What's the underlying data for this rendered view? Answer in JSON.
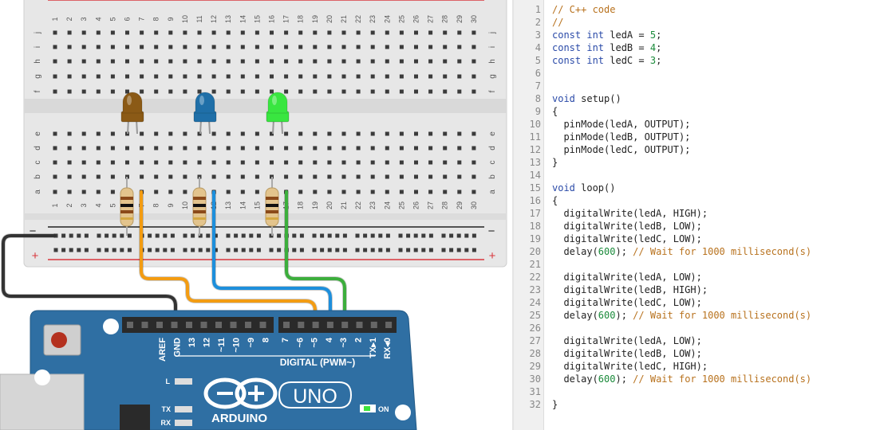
{
  "colors": {
    "breadboard": "#e7e7e7",
    "board_blue": "#2f6fa3",
    "wire_orange": "#f39c12",
    "wire_blue": "#1d8fdc",
    "wire_green": "#3cae3c",
    "wire_black": "#333333",
    "led_brown": "#8b5a16",
    "led_blue": "#1f6fa8",
    "led_green": "#39e640",
    "keyword": "#2a4aa8",
    "comment": "#b8721e",
    "number": "#1a8a3a"
  },
  "breadboard": {
    "columns": [
      "1",
      "2",
      "3",
      "4",
      "5",
      "6",
      "7",
      "8",
      "9",
      "10",
      "11",
      "12",
      "13",
      "14",
      "15",
      "16",
      "17",
      "18",
      "19",
      "20",
      "21",
      "22",
      "23",
      "24",
      "25",
      "26",
      "27",
      "28",
      "29",
      "30"
    ],
    "rows_top": [
      "j",
      "i",
      "h",
      "g",
      "f"
    ],
    "rows_bottom": [
      "e",
      "d",
      "c",
      "b",
      "a"
    ],
    "rail_minus": "−",
    "rail_plus": "+"
  },
  "arduino": {
    "header_top_labels": [
      "AREF",
      "GND",
      "13",
      "12",
      "~11",
      "~10",
      "~9",
      "8"
    ],
    "header_right_labels": [
      "7",
      "~6",
      "~5",
      "4",
      "~3",
      "2",
      "TX▸1",
      "RX◂0"
    ],
    "digital_label": "DIGITAL (PWM~)",
    "l_label": "L",
    "tx_label": "TX",
    "rx_label": "RX",
    "on_label": "ON",
    "brand": "ARDUINO",
    "model": "UNO"
  },
  "code": {
    "lines": [
      [
        {
          "t": "// C++ code",
          "c": "cm"
        }
      ],
      [
        {
          "t": "//",
          "c": "cm"
        }
      ],
      [
        {
          "t": "const int",
          "c": "kw"
        },
        {
          "t": " ledA = "
        },
        {
          "t": "5",
          "c": "num"
        },
        {
          "t": ";"
        }
      ],
      [
        {
          "t": "const int",
          "c": "kw"
        },
        {
          "t": " ledB = "
        },
        {
          "t": "4",
          "c": "num"
        },
        {
          "t": ";"
        }
      ],
      [
        {
          "t": "const int",
          "c": "kw"
        },
        {
          "t": " ledC = "
        },
        {
          "t": "3",
          "c": "num"
        },
        {
          "t": ";"
        }
      ],
      [],
      [],
      [
        {
          "t": "void",
          "c": "kw"
        },
        {
          "t": " setup()"
        }
      ],
      [
        {
          "t": "{"
        }
      ],
      [
        {
          "t": "  pinMode(ledA, OUTPUT);"
        }
      ],
      [
        {
          "t": "  pinMode(ledB, OUTPUT);"
        }
      ],
      [
        {
          "t": "  pinMode(ledC, OUTPUT);"
        }
      ],
      [
        {
          "t": "}"
        }
      ],
      [],
      [
        {
          "t": "void",
          "c": "kw"
        },
        {
          "t": " loop()"
        }
      ],
      [
        {
          "t": "{"
        }
      ],
      [
        {
          "t": "  digitalWrite(ledA, HIGH);"
        }
      ],
      [
        {
          "t": "  digitalWrite(ledB, LOW);"
        }
      ],
      [
        {
          "t": "  digitalWrite(ledC, LOW);"
        }
      ],
      [
        {
          "t": "  delay("
        },
        {
          "t": "600",
          "c": "num"
        },
        {
          "t": "); "
        },
        {
          "t": "// Wait for 1000 millisecond(s)",
          "c": "cm"
        }
      ],
      [],
      [
        {
          "t": "  digitalWrite(ledA, LOW);"
        }
      ],
      [
        {
          "t": "  digitalWrite(ledB, HIGH);"
        }
      ],
      [
        {
          "t": "  digitalWrite(ledC, LOW);"
        }
      ],
      [
        {
          "t": "  delay("
        },
        {
          "t": "600",
          "c": "num"
        },
        {
          "t": "); "
        },
        {
          "t": "// Wait for 1000 millisecond(s)",
          "c": "cm"
        }
      ],
      [],
      [
        {
          "t": "  digitalWrite(ledA, LOW);"
        }
      ],
      [
        {
          "t": "  digitalWrite(ledB, LOW);"
        }
      ],
      [
        {
          "t": "  digitalWrite(ledC, HIGH);"
        }
      ],
      [
        {
          "t": "  delay("
        },
        {
          "t": "600",
          "c": "num"
        },
        {
          "t": "); "
        },
        {
          "t": "// Wait for 1000 millisecond(s)",
          "c": "cm"
        }
      ],
      [],
      [
        {
          "t": "}"
        }
      ]
    ]
  }
}
